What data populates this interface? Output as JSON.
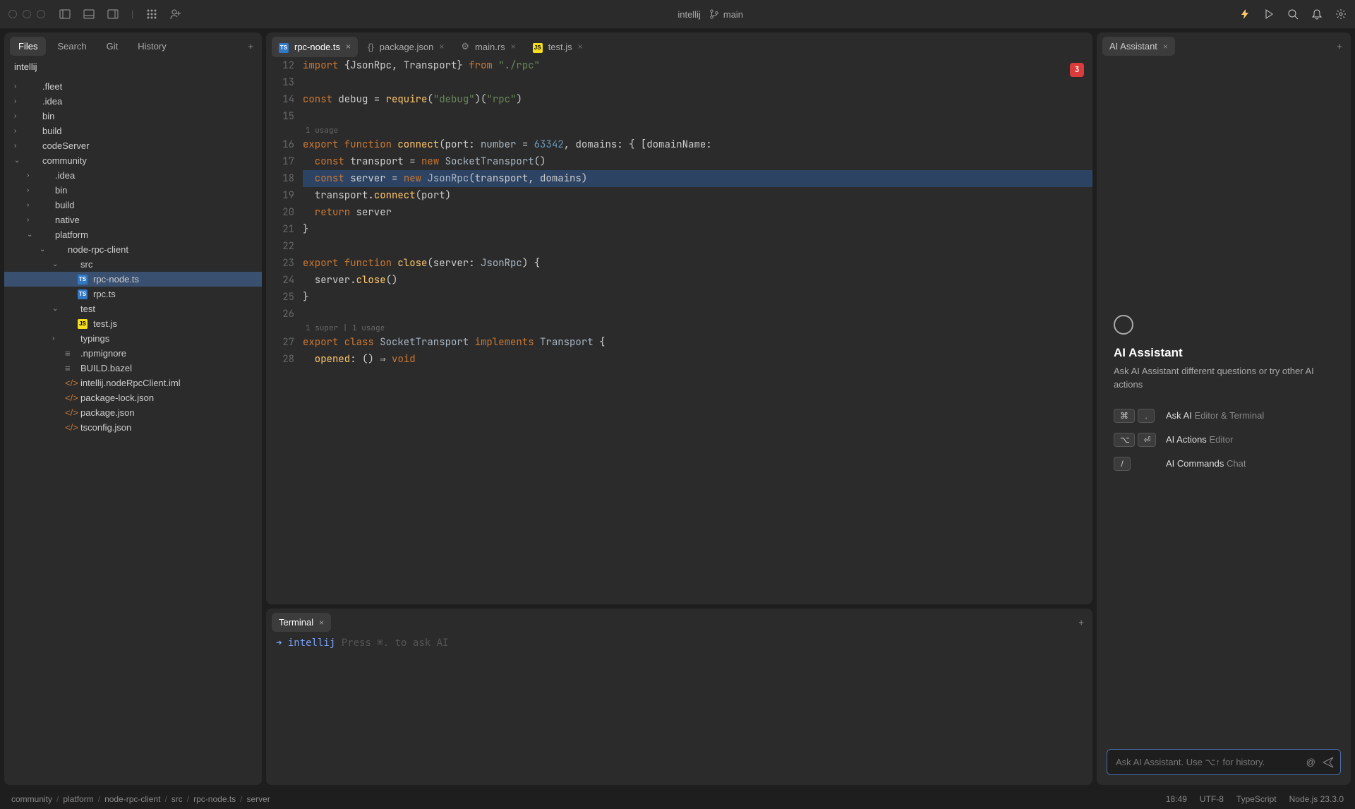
{
  "titlebar": {
    "project": "intellij",
    "branch": "main"
  },
  "leftPanel": {
    "tabs": [
      "Files",
      "Search",
      "Git",
      "History"
    ],
    "activeTab": 0,
    "projectName": "intellij",
    "tree": [
      {
        "name": ".fleet",
        "type": "folder",
        "indent": 0,
        "expanded": false
      },
      {
        "name": ".idea",
        "type": "folder",
        "indent": 0,
        "expanded": false
      },
      {
        "name": "bin",
        "type": "folder",
        "indent": 0,
        "expanded": false
      },
      {
        "name": "build",
        "type": "folder",
        "indent": 0,
        "expanded": false
      },
      {
        "name": "codeServer",
        "type": "folder",
        "indent": 0,
        "expanded": false
      },
      {
        "name": "community",
        "type": "folder",
        "indent": 0,
        "expanded": true
      },
      {
        "name": ".idea",
        "type": "folder",
        "indent": 1,
        "expanded": false
      },
      {
        "name": "bin",
        "type": "folder",
        "indent": 1,
        "expanded": false
      },
      {
        "name": "build",
        "type": "folder",
        "indent": 1,
        "expanded": false
      },
      {
        "name": "native",
        "type": "folder",
        "indent": 1,
        "expanded": false
      },
      {
        "name": "platform",
        "type": "folder",
        "indent": 1,
        "expanded": true
      },
      {
        "name": "node-rpc-client",
        "type": "folder",
        "indent": 2,
        "expanded": true
      },
      {
        "name": "src",
        "type": "folder",
        "indent": 3,
        "expanded": true
      },
      {
        "name": "rpc-node.ts",
        "type": "ts",
        "indent": 4,
        "selected": true
      },
      {
        "name": "rpc.ts",
        "type": "ts",
        "indent": 4
      },
      {
        "name": "test",
        "type": "folder",
        "indent": 3,
        "expanded": true
      },
      {
        "name": "test.js",
        "type": "js",
        "indent": 4
      },
      {
        "name": "typings",
        "type": "folder",
        "indent": 3,
        "expanded": false
      },
      {
        "name": ".npmignore",
        "type": "file",
        "indent": 3
      },
      {
        "name": "BUILD.bazel",
        "type": "file",
        "indent": 3
      },
      {
        "name": "intellij.nodeRpcClient.iml",
        "type": "code",
        "indent": 3
      },
      {
        "name": "package-lock.json",
        "type": "code",
        "indent": 3
      },
      {
        "name": "package.json",
        "type": "code",
        "indent": 3
      },
      {
        "name": "tsconfig.json",
        "type": "code",
        "indent": 3
      }
    ]
  },
  "editor": {
    "tabs": [
      {
        "name": "rpc-node.ts",
        "icon": "ts",
        "active": true
      },
      {
        "name": "package.json",
        "icon": "json"
      },
      {
        "name": "main.rs",
        "icon": "rust"
      },
      {
        "name": "test.js",
        "icon": "js"
      }
    ],
    "errorCount": "3",
    "lines": [
      {
        "n": "12",
        "tokens": [
          {
            "t": "import ",
            "c": "kw"
          },
          {
            "t": "{JsonRpc, Transport} ",
            "c": "op"
          },
          {
            "t": "from ",
            "c": "kw"
          },
          {
            "t": "\"./rpc\"",
            "c": "str"
          }
        ]
      },
      {
        "n": "13",
        "tokens": []
      },
      {
        "n": "14",
        "tokens": [
          {
            "t": "const ",
            "c": "kw"
          },
          {
            "t": "debug = ",
            "c": "op"
          },
          {
            "t": "require",
            "c": "fn"
          },
          {
            "t": "(",
            "c": "op"
          },
          {
            "t": "\"debug\"",
            "c": "str"
          },
          {
            "t": ")(",
            "c": "op"
          },
          {
            "t": "\"rpc\"",
            "c": "str"
          },
          {
            "t": ")",
            "c": "op"
          }
        ]
      },
      {
        "n": "15",
        "tokens": []
      },
      {
        "annotation": "1 usage"
      },
      {
        "n": "16",
        "tokens": [
          {
            "t": "export function ",
            "c": "kw"
          },
          {
            "t": "connect",
            "c": "fn"
          },
          {
            "t": "(port: ",
            "c": "op"
          },
          {
            "t": "number ",
            "c": "type"
          },
          {
            "t": "= ",
            "c": "op"
          },
          {
            "t": "63342",
            "c": "num"
          },
          {
            "t": ", domains: { [domainName:",
            "c": "op"
          }
        ]
      },
      {
        "n": "17",
        "tokens": [
          {
            "t": "  const ",
            "c": "kw"
          },
          {
            "t": "transport = ",
            "c": "op"
          },
          {
            "t": "new ",
            "c": "kw"
          },
          {
            "t": "SocketTransport",
            "c": "cls"
          },
          {
            "t": "()",
            "c": "op"
          }
        ]
      },
      {
        "n": "18",
        "hl": true,
        "tokens": [
          {
            "t": "  const ",
            "c": "kw"
          },
          {
            "t": "server = ",
            "c": "op"
          },
          {
            "t": "new ",
            "c": "kw"
          },
          {
            "t": "JsonRpc",
            "c": "cls"
          },
          {
            "t": "(transport, domains)",
            "c": "op"
          }
        ]
      },
      {
        "n": "19",
        "tokens": [
          {
            "t": "  transport.",
            "c": "op"
          },
          {
            "t": "connect",
            "c": "fn"
          },
          {
            "t": "(port)",
            "c": "op"
          }
        ]
      },
      {
        "n": "20",
        "tokens": [
          {
            "t": "  return ",
            "c": "kw"
          },
          {
            "t": "server",
            "c": "op"
          }
        ]
      },
      {
        "n": "21",
        "tokens": [
          {
            "t": "}",
            "c": "op"
          }
        ]
      },
      {
        "n": "22",
        "tokens": []
      },
      {
        "n": "23",
        "tokens": [
          {
            "t": "export function ",
            "c": "kw"
          },
          {
            "t": "close",
            "c": "fn"
          },
          {
            "t": "(server: ",
            "c": "op"
          },
          {
            "t": "JsonRpc",
            "c": "type"
          },
          {
            "t": ") {",
            "c": "op"
          }
        ]
      },
      {
        "n": "24",
        "tokens": [
          {
            "t": "  server.",
            "c": "op"
          },
          {
            "t": "close",
            "c": "fn"
          },
          {
            "t": "()",
            "c": "op"
          }
        ]
      },
      {
        "n": "25",
        "tokens": [
          {
            "t": "}",
            "c": "op"
          }
        ]
      },
      {
        "n": "26",
        "tokens": []
      },
      {
        "annotation": "1 super | 1 usage"
      },
      {
        "n": "27",
        "tokens": [
          {
            "t": "export class ",
            "c": "kw"
          },
          {
            "t": "SocketTransport ",
            "c": "cls"
          },
          {
            "t": "implements ",
            "c": "kw"
          },
          {
            "t": "Transport ",
            "c": "type"
          },
          {
            "t": "{",
            "c": "op"
          }
        ]
      },
      {
        "n": "28",
        "tokens": [
          {
            "t": "  opened",
            "c": "fn"
          },
          {
            "t": ": () ",
            "c": "op"
          },
          {
            "t": "⇒ ",
            "c": "op"
          },
          {
            "t": "void",
            "c": "kw"
          }
        ]
      }
    ]
  },
  "terminal": {
    "tabName": "Terminal",
    "promptPath": "intellij",
    "promptHint": "Press ⌘. to ask AI"
  },
  "aiPanel": {
    "tabName": "AI Assistant",
    "title": "AI Assistant",
    "description": "Ask AI Assistant different questions or try other AI actions",
    "shortcuts": [
      {
        "keys": [
          "⌘",
          "."
        ],
        "label": "Ask AI",
        "sub": "Editor & Terminal"
      },
      {
        "keys": [
          "⌥",
          "⏎"
        ],
        "label": "AI Actions",
        "sub": "Editor"
      },
      {
        "keys": [
          "/"
        ],
        "label": "AI Commands",
        "sub": "Chat"
      }
    ],
    "inputPlaceholder": "Ask AI Assistant. Use ⌥↑ for history."
  },
  "breadcrumbs": [
    "community",
    "platform",
    "node-rpc-client",
    "src",
    "rpc-node.ts",
    "server"
  ],
  "statusRight": {
    "time": "18:49",
    "encoding": "UTF-8",
    "lang": "TypeScript",
    "runtime": "Node.js 23.3.0"
  }
}
